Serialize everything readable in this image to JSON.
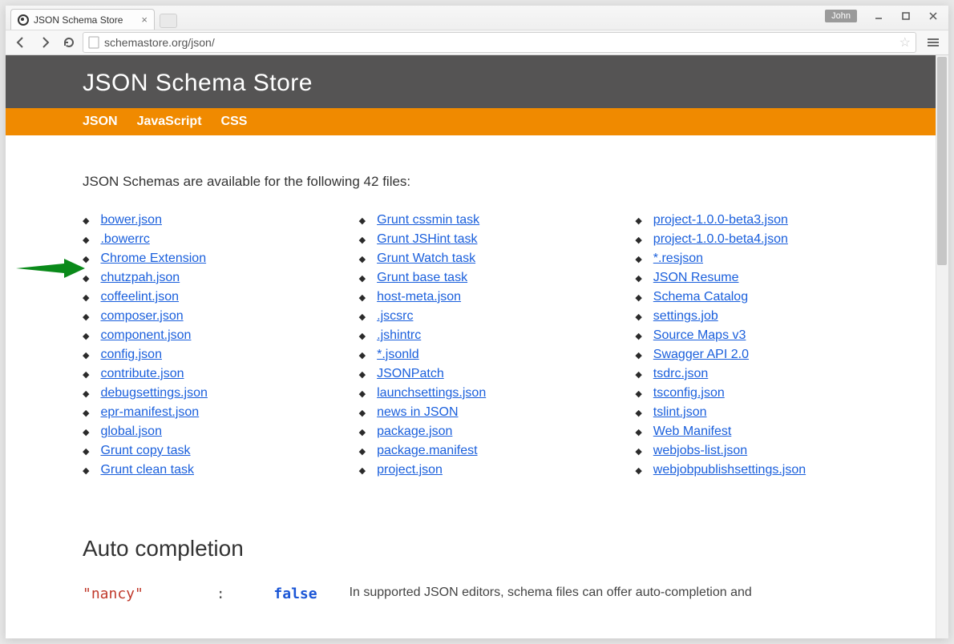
{
  "window": {
    "tab_title": "JSON Schema Store",
    "user_label": "John",
    "url": "schemastore.org/json/"
  },
  "hero": {
    "title": "JSON Schema Store"
  },
  "nav": {
    "items": [
      "JSON",
      "JavaScript",
      "CSS"
    ]
  },
  "intro": {
    "text": "JSON Schemas are available for the following 42 files:"
  },
  "schemas": {
    "col1": [
      "bower.json",
      ".bowerrc",
      "Chrome Extension",
      "chutzpah.json",
      "coffeelint.json",
      "composer.json",
      "component.json",
      "config.json",
      "contribute.json",
      "debugsettings.json",
      "epr-manifest.json",
      "global.json",
      "Grunt copy task",
      "Grunt clean task"
    ],
    "col2": [
      "Grunt cssmin task",
      "Grunt JSHint task",
      "Grunt Watch task",
      "Grunt base task",
      "host-meta.json",
      ".jscsrc",
      ".jshintrc",
      "*.jsonld",
      "JSONPatch",
      "launchsettings.json",
      "news in JSON",
      "package.json",
      "package.manifest",
      "project.json"
    ],
    "col3": [
      "project-1.0.0-beta3.json",
      "project-1.0.0-beta4.json",
      "*.resjson",
      "JSON Resume",
      "Schema Catalog",
      "settings.job",
      "Source Maps v3",
      "Swagger API 2.0",
      "tsdrc.json",
      "tsconfig.json",
      "tslint.json",
      "Web Manifest",
      "webjobs-list.json",
      "webjobpublishsettings.json"
    ]
  },
  "section2": {
    "heading": "Auto completion"
  },
  "code": {
    "key": "\"nancy\"",
    "colon": ":",
    "value": "false"
  },
  "code_desc": "In supported JSON editors, schema files can offer auto-completion and"
}
